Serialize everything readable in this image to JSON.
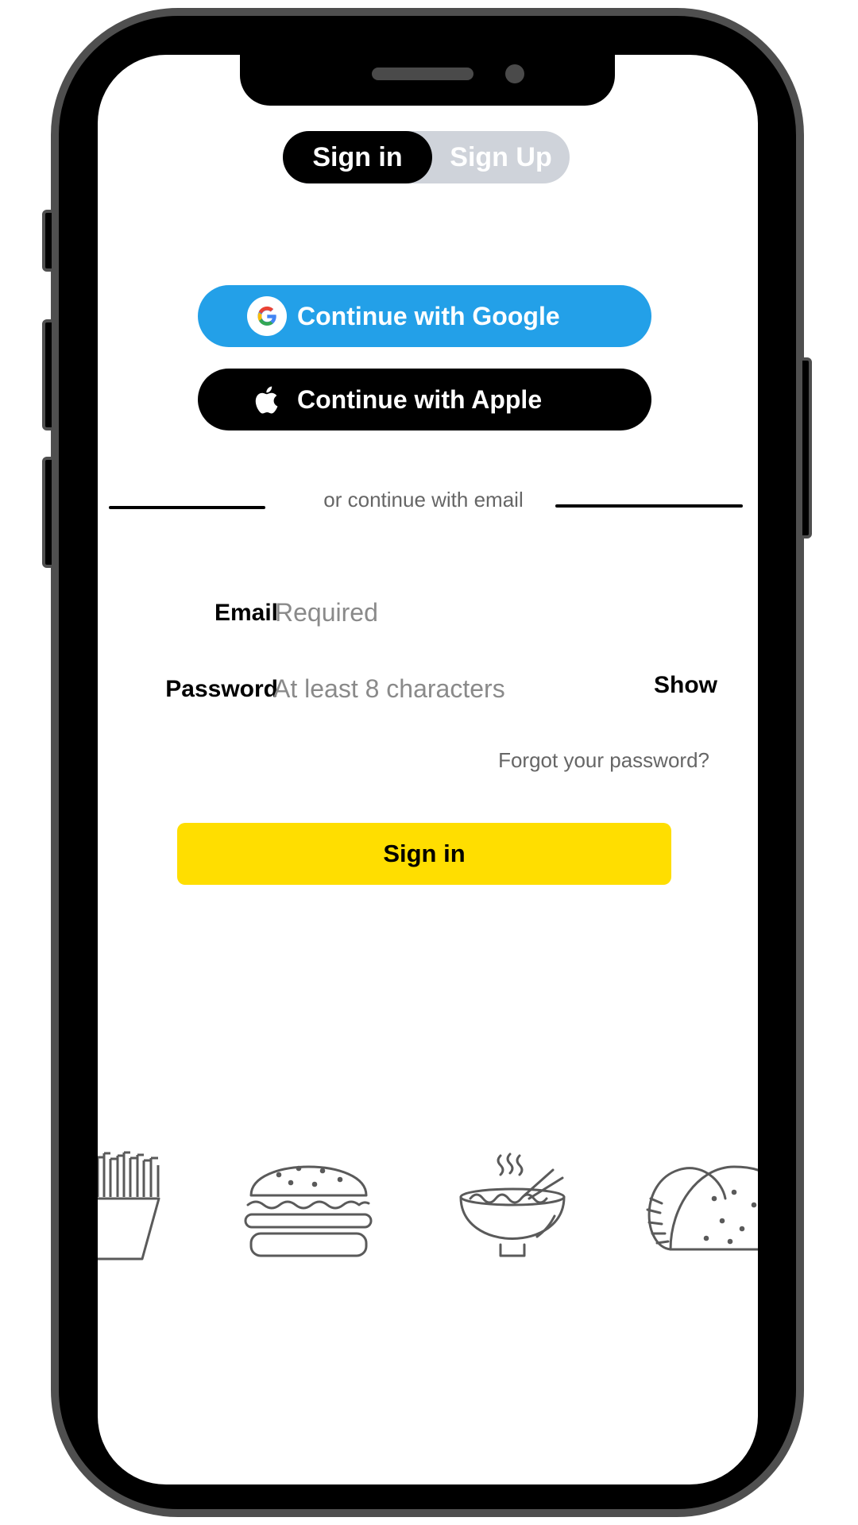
{
  "auth_tabs": {
    "sign_in": "Sign in",
    "sign_up": "Sign Up"
  },
  "social": {
    "google_label": "Continue with Google",
    "apple_label": "Continue with Apple"
  },
  "divider_text": "or continue with email",
  "form": {
    "email_label": "Email",
    "email_placeholder": "Required",
    "email_value": "",
    "password_label": "Password",
    "password_placeholder": "At least 8 characters",
    "password_value": "",
    "show_label": "Show",
    "forgot_link": "Forgot your password?",
    "submit_label": "Sign in"
  },
  "illustrations": [
    "fries-icon",
    "burger-icon",
    "noodle-bowl-icon",
    "taco-icon"
  ],
  "colors": {
    "google_button": "#23a0e8",
    "apple_button": "#000000",
    "submit_button": "#ffde00",
    "segment_track": "#cfd3da",
    "phone_bezel": "#4f4f4f",
    "illustration_stroke": "#5a5a5a"
  }
}
